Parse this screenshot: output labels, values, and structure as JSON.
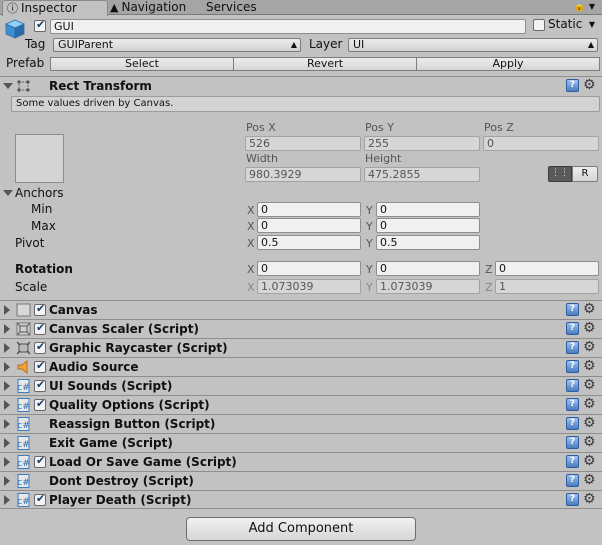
{
  "tabs": [
    {
      "label": "Inspector",
      "active": true,
      "icon": "info-icon"
    },
    {
      "label": "Navigation",
      "active": false,
      "icon": "navigation-icon"
    },
    {
      "label": "Services",
      "active": false,
      "icon": ""
    }
  ],
  "header": {
    "object_name": "GUI",
    "active_checked": true,
    "static_label": "Static",
    "static_checked": false,
    "tag_label": "Tag",
    "tag_value": "GUIParent",
    "layer_label": "Layer",
    "layer_value": "UI",
    "prefab_label": "Prefab",
    "prefab_buttons": [
      "Select",
      "Revert",
      "Apply"
    ]
  },
  "rect_transform": {
    "title": "Rect Transform",
    "note": "Some values driven by Canvas.",
    "pos_x_label": "Pos X",
    "pos_x": "526",
    "pos_y_label": "Pos Y",
    "pos_y": "255",
    "pos_z_label": "Pos Z",
    "pos_z": "0",
    "width_label": "Width",
    "width": "980.3929",
    "height_label": "Height",
    "height": "475.2855",
    "r_button": "R",
    "anchors_label": "Anchors",
    "min_label": "Min",
    "min_x": "0",
    "min_y": "0",
    "max_label": "Max",
    "max_x": "0",
    "max_y": "0",
    "pivot_label": "Pivot",
    "pivot_x": "0.5",
    "pivot_y": "0.5",
    "rotation_label": "Rotation",
    "rot_x": "0",
    "rot_y": "0",
    "rot_z": "0",
    "scale_label": "Scale",
    "scale_x": "1.073039",
    "scale_y": "1.073039",
    "scale_z": "1",
    "axis_x": "X",
    "axis_y": "Y",
    "axis_z": "Z"
  },
  "components": [
    {
      "name": "Canvas",
      "icon": "canvas-icon",
      "checked": true
    },
    {
      "name": "Canvas Scaler (Script)",
      "icon": "canvas-scaler-icon",
      "checked": true
    },
    {
      "name": "Graphic Raycaster (Script)",
      "icon": "raycaster-icon",
      "checked": true
    },
    {
      "name": "Audio Source",
      "icon": "audio-speaker-icon",
      "checked": true
    },
    {
      "name": "UI Sounds (Script)",
      "icon": "script-icon",
      "checked": true
    },
    {
      "name": "Quality Options (Script)",
      "icon": "script-icon",
      "checked": true
    },
    {
      "name": "Reassign Button (Script)",
      "icon": "script-icon",
      "checked": null
    },
    {
      "name": "Exit Game (Script)",
      "icon": "script-icon",
      "checked": null
    },
    {
      "name": "Load Or Save Game (Script)",
      "icon": "script-icon",
      "checked": true
    },
    {
      "name": "Dont Destroy (Script)",
      "icon": "script-icon",
      "checked": null
    },
    {
      "name": "Player Death (Script)",
      "icon": "script-icon",
      "checked": true
    }
  ],
  "add_component_label": "Add Component"
}
